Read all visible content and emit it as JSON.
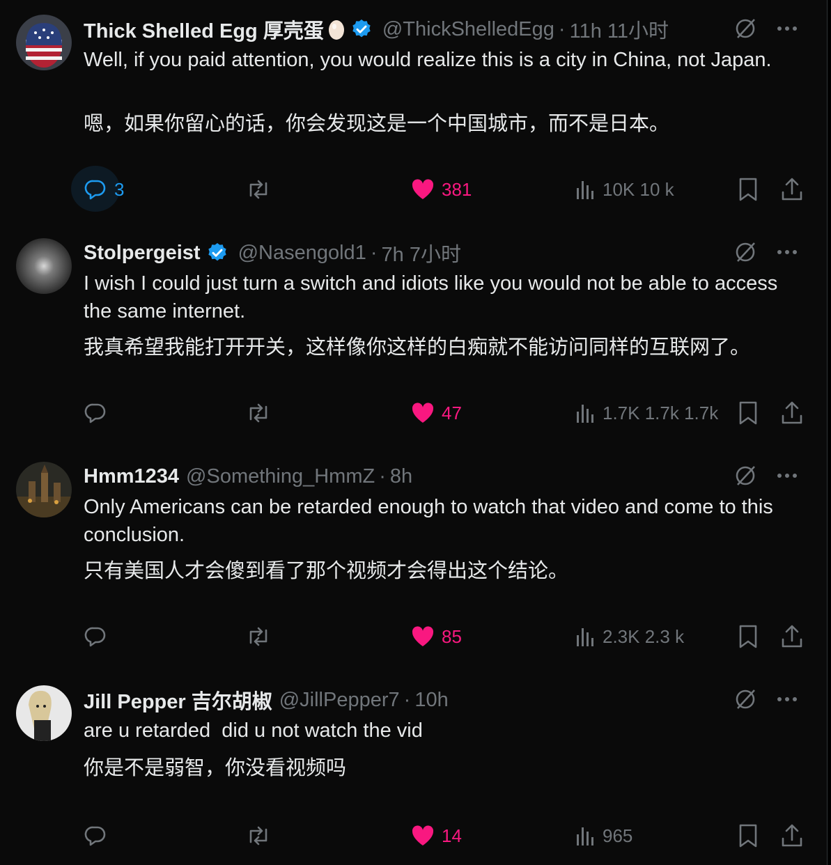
{
  "tweets": [
    {
      "name": "Thick Shelled Egg 厚壳蛋",
      "handle": "@ThickShelledEgg",
      "time": "11h 11小时",
      "verified": true,
      "text_en": "Well, if you paid attention, you would realize this is a city in China, not Japan.",
      "text_zh": "嗯，如果你留心的话，你会发现这是一个中国城市，而不是日本。",
      "replies": "3",
      "retweets": "",
      "likes": "381",
      "views": "10K 10 k"
    },
    {
      "name": "Stolpergeist",
      "handle": "@Nasengold1",
      "time": "7h 7小时",
      "verified": true,
      "text_en": "I wish I could just turn a switch and idiots like you would not be able to access the same internet.",
      "text_zh": "我真希望我能打开开关，这样像你这样的白痴就不能访问同样的互联网了。",
      "replies": "",
      "retweets": "",
      "likes": "47",
      "views": "1.7K 1.7k 1.7k"
    },
    {
      "name": "Hmm1234",
      "handle": "@Something_HmmZ",
      "time": "8h",
      "verified": false,
      "text_en": "Only Americans can be retarded enough to watch that video and come to this conclusion.",
      "text_zh": "只有美国人才会傻到看了那个视频才会得出这个结论。",
      "replies": "",
      "retweets": "",
      "likes": "85",
      "views": "2.3K 2.3 k"
    },
    {
      "name": "Jill Pepper 吉尔胡椒",
      "handle": "@JillPepper7",
      "time": "10h",
      "verified": false,
      "text_en": "are u retarded  did u not watch the vid",
      "text_zh": "你是不是弱智，你没看视频吗",
      "replies": "",
      "retweets": "",
      "likes": "14",
      "views": "965"
    }
  ],
  "colors": {
    "background": "#000000",
    "text": "#e7e9ea",
    "muted": "#71767b",
    "like": "#f91880",
    "verified": "#1d9bf0"
  },
  "icons": [
    "egg-emoji-icon",
    "verified-badge-icon",
    "grok-icon",
    "more-icon",
    "reply-icon",
    "retweet-icon",
    "heart-icon",
    "views-icon",
    "bookmark-icon",
    "share-icon"
  ]
}
